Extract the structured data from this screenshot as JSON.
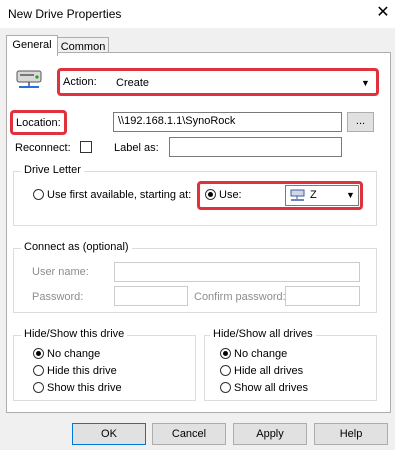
{
  "window": {
    "title": "New Drive Properties",
    "close_glyph": "✕"
  },
  "tabs": [
    {
      "label": "General"
    },
    {
      "label": "Common"
    }
  ],
  "action": {
    "label": "Action:",
    "value": "Create"
  },
  "location": {
    "label": "Location:",
    "value": "\\\\192.168.1.1\\SynoRock",
    "browse_label": "..."
  },
  "reconnect": {
    "label": "Reconnect:",
    "checked": false
  },
  "label_as": {
    "label": "Label as:",
    "value": ""
  },
  "drive_letter": {
    "title": "Drive Letter",
    "first_available_label": "Use first available, starting at:",
    "use_label": "Use:",
    "use_value": "Z",
    "selected": "use"
  },
  "connect_as": {
    "title": "Connect as (optional)",
    "username_label": "User name:",
    "password_label": "Password:",
    "confirm_label": "Confirm password:"
  },
  "hide_show_drive": {
    "title": "Hide/Show this drive",
    "options": [
      {
        "label": "No change",
        "selected": true
      },
      {
        "label": "Hide this drive",
        "selected": false
      },
      {
        "label": "Show this drive",
        "selected": false
      }
    ]
  },
  "hide_show_all": {
    "title": "Hide/Show all drives",
    "options": [
      {
        "label": "No change",
        "selected": true
      },
      {
        "label": "Hide all drives",
        "selected": false
      },
      {
        "label": "Show all drives",
        "selected": false
      }
    ]
  },
  "buttons": {
    "ok": "OK",
    "cancel": "Cancel",
    "apply": "Apply",
    "help": "Help"
  },
  "colors": {
    "highlight": "#e0323c",
    "focus": "#0078d7"
  },
  "icons": {
    "drive": "network-drive-icon",
    "dropdown": "chevron-down-icon"
  }
}
